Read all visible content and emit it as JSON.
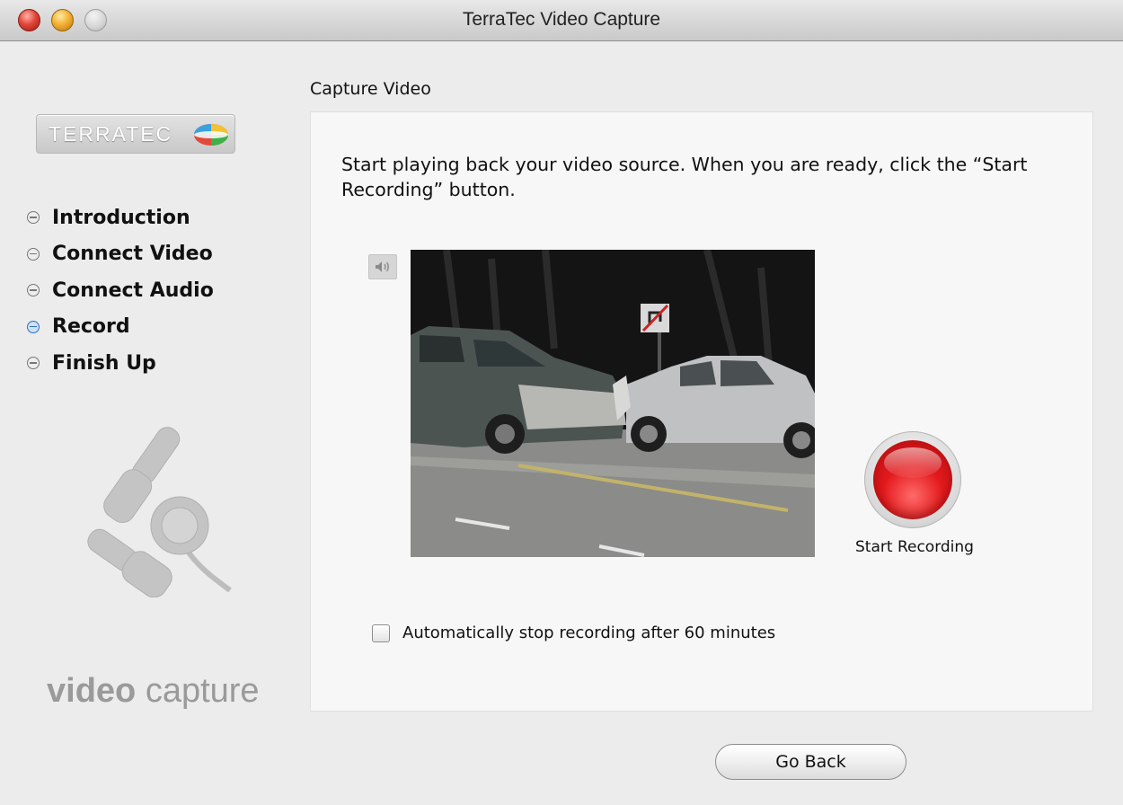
{
  "window": {
    "title": "TerraTec Video Capture"
  },
  "sidebar": {
    "logo_text": "TERRATEC",
    "steps": [
      {
        "label": "Introduction",
        "active": false
      },
      {
        "label": "Connect Video",
        "active": false
      },
      {
        "label": "Connect Audio",
        "active": false
      },
      {
        "label": "Record",
        "active": true
      },
      {
        "label": "Finish Up",
        "active": false
      }
    ],
    "product_label_bold": "video",
    "product_label_light": "capture"
  },
  "main": {
    "section_title": "Capture Video",
    "instructions": "Start playing back your video source. When you are ready, click the “Start Recording” button.",
    "record_label": "Start Recording",
    "auto_stop_label": "Automatically stop recording after 60 minutes",
    "auto_stop_checked": false
  },
  "footer": {
    "go_back_label": "Go Back"
  },
  "colors": {
    "active_step": "#2b6fc8",
    "record_red": "#e3191c",
    "window_bg": "#ececec"
  }
}
